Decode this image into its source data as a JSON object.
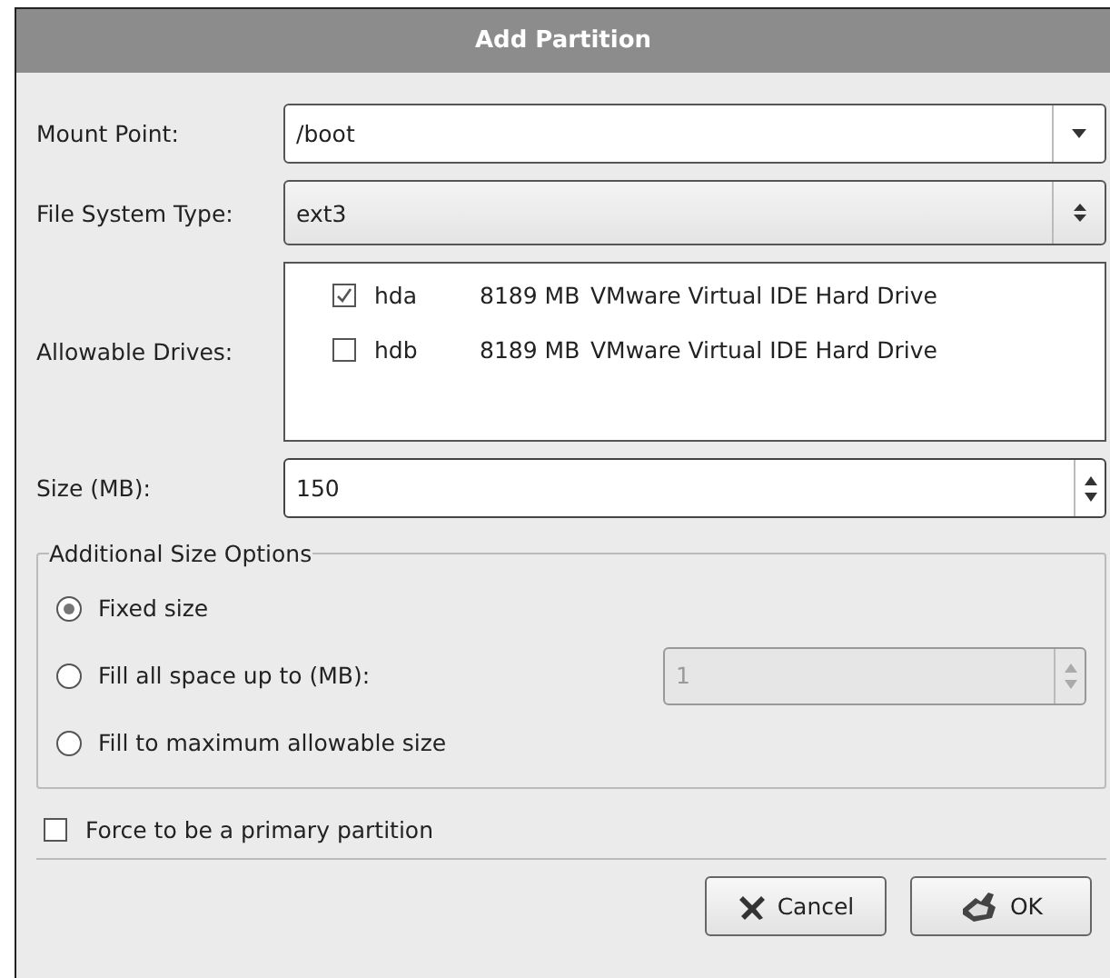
{
  "window": {
    "title": "Add Partition"
  },
  "mount_point": {
    "label": "Mount Point:",
    "value": "/boot"
  },
  "file_system_type": {
    "label": "File System Type:",
    "value": "ext3"
  },
  "allowable_drives": {
    "label": "Allowable Drives:",
    "drives": [
      {
        "name": "hda",
        "size": "8189 MB",
        "model": "VMware Virtual IDE Hard Drive",
        "checked": true
      },
      {
        "name": "hdb",
        "size": "8189 MB",
        "model": "VMware Virtual IDE Hard Drive",
        "checked": false
      }
    ]
  },
  "size": {
    "label": "Size (MB):",
    "value": "150"
  },
  "additional_size_options": {
    "title": "Additional Size Options",
    "options": [
      {
        "label": "Fixed size",
        "selected": true
      },
      {
        "label": "Fill all space up to (MB):",
        "selected": false,
        "spin": {
          "value": "1",
          "disabled": true
        }
      },
      {
        "label": "Fill to maximum allowable size",
        "selected": false
      }
    ]
  },
  "force_primary": {
    "label": "Force to be a primary partition",
    "checked": false
  },
  "buttons": [
    {
      "kind": "cancel",
      "label": "Cancel"
    },
    {
      "kind": "ok",
      "label": "OK"
    }
  ]
}
